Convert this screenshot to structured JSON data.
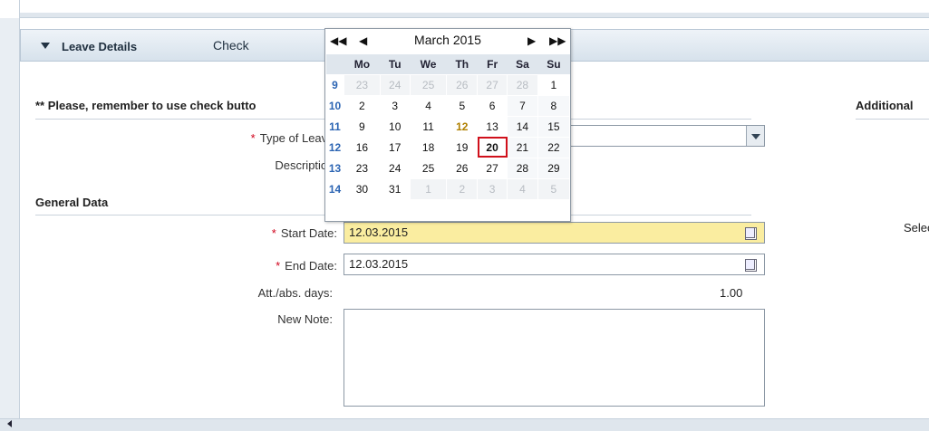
{
  "panel": {
    "section_title": "Leave Details",
    "check_label": "Check",
    "note": "** Please, remember to use check butto",
    "additional": "Additional",
    "select_label": "Select"
  },
  "form": {
    "type_label": "Type of Leave:",
    "type_value": "",
    "description_label": "Description:",
    "general_data": "General Data",
    "start_label": "Start Date:",
    "start_value": "12.03.2015",
    "end_label": "End Date:",
    "end_value": "12.03.2015",
    "days_label": "Att./abs. days:",
    "days_value": "1.00",
    "note_label": "New Note:",
    "note_value": ""
  },
  "calendar": {
    "title": "March 2015",
    "nav": {
      "prev_year": "◀◀",
      "prev_month": "◀",
      "next_month": "▶",
      "next_year": "▶▶"
    },
    "weekdays": [
      "Mo",
      "Tu",
      "We",
      "Th",
      "Fr",
      "Sa",
      "Su"
    ],
    "selected_day": "20",
    "today": "12",
    "weeks": [
      {
        "week": "9",
        "days": [
          "23",
          "24",
          "25",
          "26",
          "27",
          "28",
          "1"
        ]
      },
      {
        "week": "10",
        "days": [
          "2",
          "3",
          "4",
          "5",
          "6",
          "7",
          "8"
        ]
      },
      {
        "week": "11",
        "days": [
          "9",
          "10",
          "11",
          "12",
          "13",
          "14",
          "15"
        ]
      },
      {
        "week": "12",
        "days": [
          "16",
          "17",
          "18",
          "19",
          "20",
          "21",
          "22"
        ]
      },
      {
        "week": "13",
        "days": [
          "23",
          "24",
          "25",
          "26",
          "27",
          "28",
          "29"
        ]
      },
      {
        "week": "14",
        "days": [
          "30",
          "31",
          "1",
          "2",
          "3",
          "4",
          "5"
        ]
      }
    ]
  }
}
